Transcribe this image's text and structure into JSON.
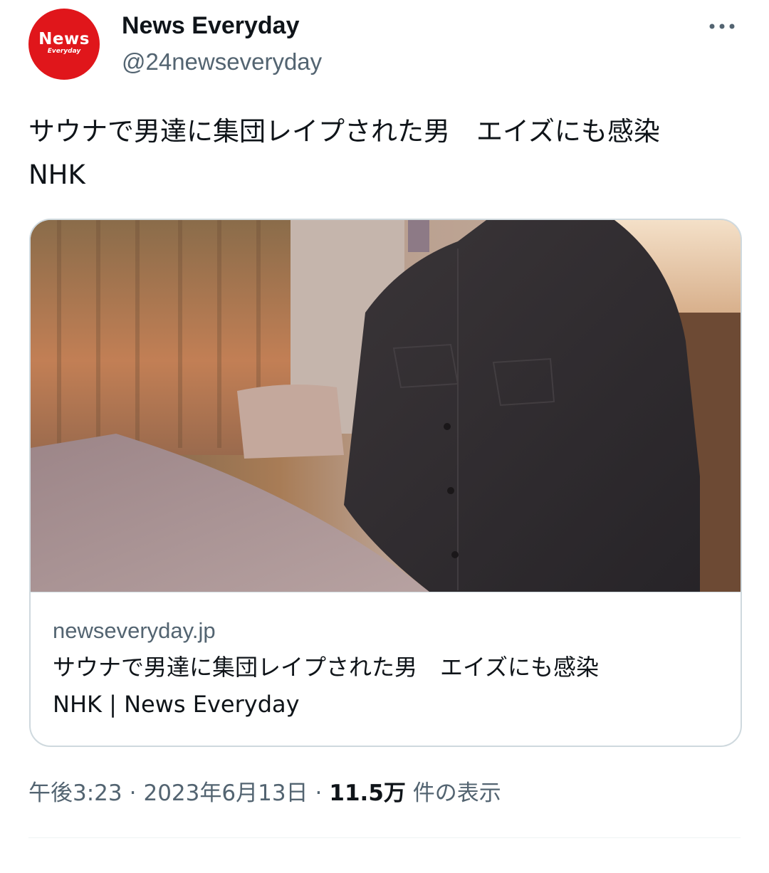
{
  "author": {
    "name": "News Everyday",
    "handle": "@24newseveryday",
    "avatar_text": "News",
    "avatar_subtext": "Everyday",
    "avatar_color": "#e0161b"
  },
  "more_icon": "more-horizontal-icon",
  "tweet": {
    "text": "サウナで男達に集団レイプされた男　エイズにも感染　NHK"
  },
  "link_card": {
    "domain": "newseveryday.jp",
    "title": "サウナで男達に集団レイプされた男　エイズにも感染\nNHK | News Everyday"
  },
  "meta": {
    "time": "午後3:23",
    "date": "2023年6月13日",
    "view_count": "11.5万",
    "view_label": "件の表示"
  },
  "colors": {
    "text": "#0f1419",
    "secondary": "#536471",
    "border": "#cfd9de"
  }
}
